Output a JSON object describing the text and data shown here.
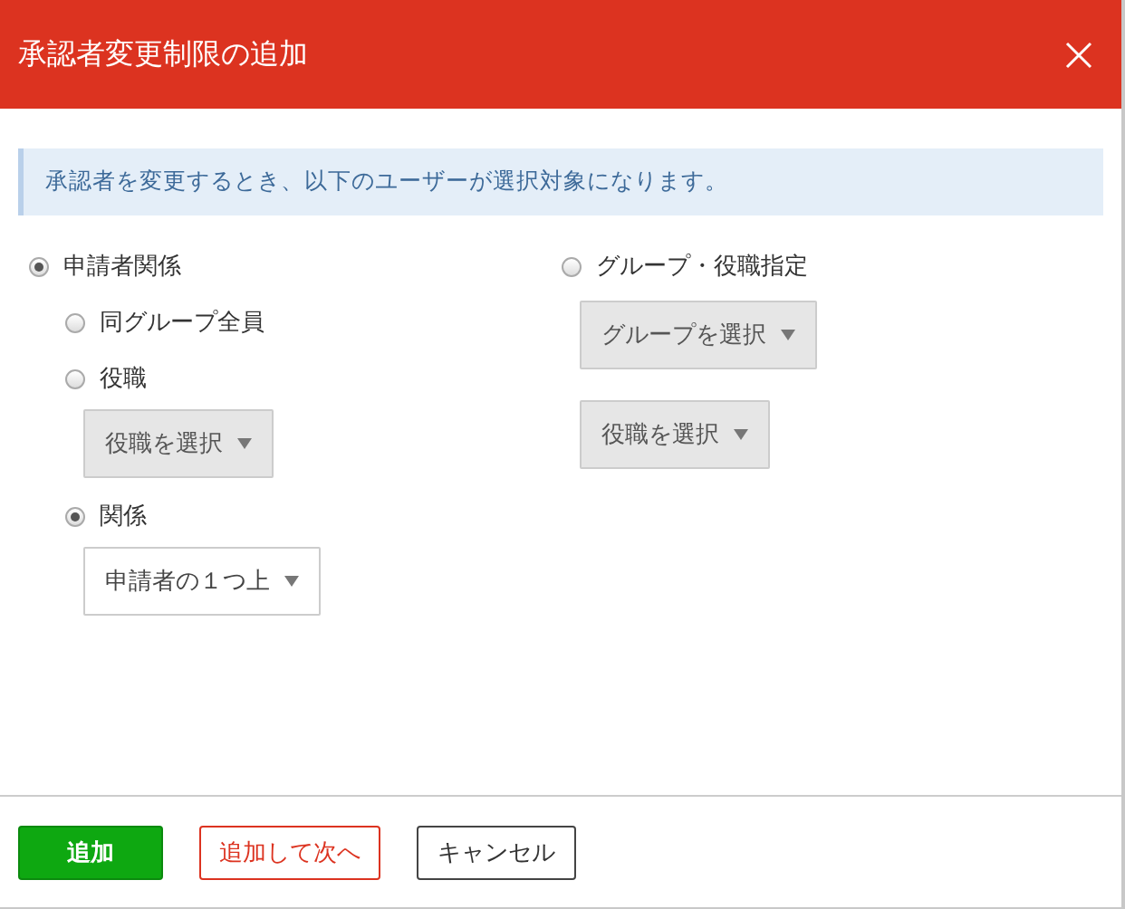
{
  "dialog": {
    "title": "承認者変更制限の追加"
  },
  "notice": "承認者を変更するとき、以下のユーザーが選択対象になります。",
  "options": [
    {
      "label": "申請者関係",
      "selected": true,
      "children": [
        {
          "label": "同グループ全員",
          "selected": false
        },
        {
          "label": "役職",
          "selected": false,
          "dropdowns": [
            {
              "label": "役職を選択",
              "disabled": true
            }
          ]
        },
        {
          "label": "関係",
          "selected": true,
          "dropdowns": [
            {
              "label": "申請者の１つ上",
              "disabled": false
            }
          ]
        }
      ]
    },
    {
      "label": "グループ・役職指定",
      "selected": false,
      "dropdowns": [
        {
          "label": "グループを選択",
          "disabled": true
        },
        {
          "label": "役職を選択",
          "disabled": true
        }
      ]
    }
  ],
  "buttons": [
    {
      "label": "追加",
      "kind": "primary"
    },
    {
      "label": "追加して次へ",
      "kind": "danger"
    },
    {
      "label": "キャンセル",
      "kind": "default"
    }
  ]
}
